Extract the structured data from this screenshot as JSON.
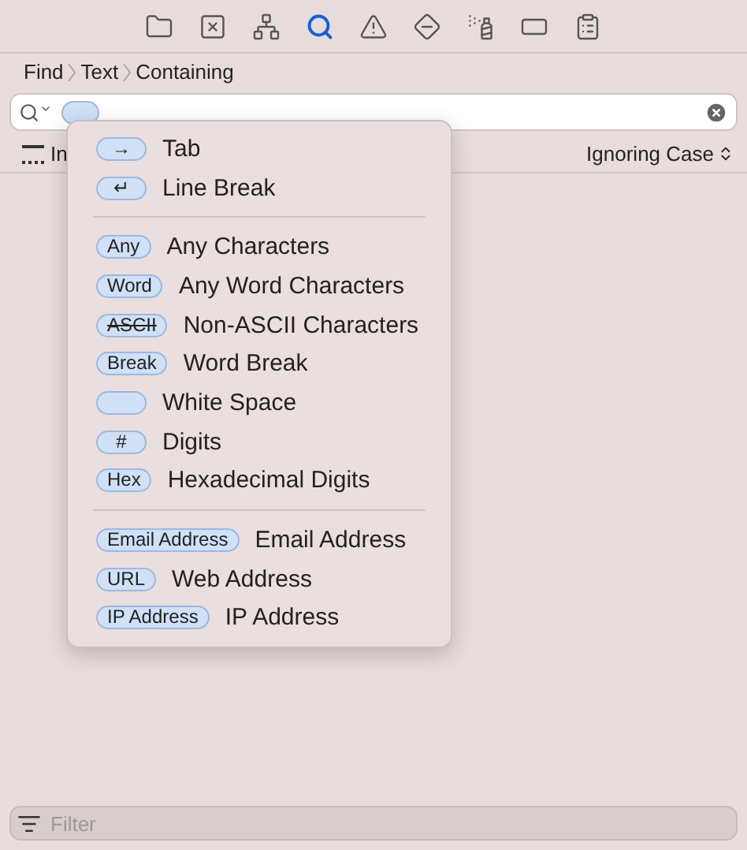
{
  "toolbar": {
    "items": [
      {
        "selected": false
      },
      {
        "selected": false
      },
      {
        "selected": false
      },
      {
        "selected": true
      },
      {
        "selected": false
      },
      {
        "selected": false
      },
      {
        "selected": false
      },
      {
        "selected": false
      },
      {
        "selected": false
      }
    ]
  },
  "breadcrumb": [
    "Find",
    "Text",
    "Containing"
  ],
  "options": {
    "label": "In",
    "case_mode": "Ignoring Case"
  },
  "menu": {
    "sections": [
      [
        {
          "token": "→",
          "label": "Tab",
          "struck": false
        },
        {
          "token": "↵",
          "label": "Line Break",
          "struck": false
        }
      ],
      [
        {
          "token": "Any",
          "label": "Any Characters",
          "struck": false
        },
        {
          "token": "Word",
          "label": "Any Word Characters",
          "struck": false
        },
        {
          "token": "ASCII",
          "label": "Non-ASCII Characters",
          "struck": true
        },
        {
          "token": "Break",
          "label": "Word Break",
          "struck": false
        },
        {
          "label": "White Space",
          "struck": false
        },
        {
          "token": "#",
          "label": "Digits",
          "struck": false
        },
        {
          "token": "Hex",
          "label": "Hexadecimal Digits",
          "struck": false
        }
      ],
      [
        {
          "token": "Email Address",
          "label": "Email Address",
          "struck": false
        },
        {
          "token": "URL",
          "label": "Web Address",
          "struck": false
        },
        {
          "token": "IP Address",
          "label": "IP Address",
          "struck": false
        }
      ]
    ]
  },
  "filter": {
    "placeholder": "Filter"
  }
}
